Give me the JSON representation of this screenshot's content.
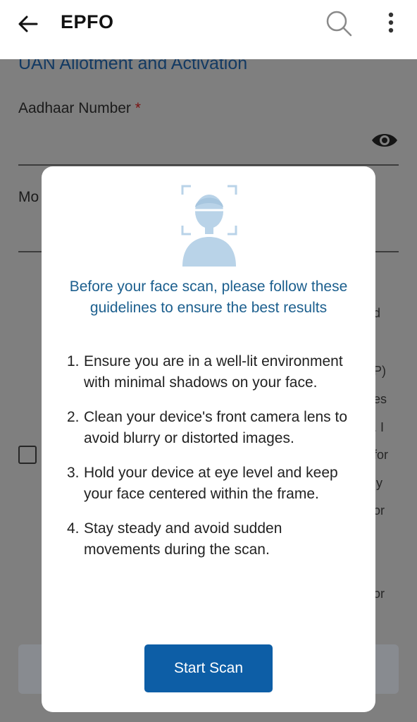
{
  "app_bar": {
    "title": "EPFO",
    "back_icon": "arrow-left-icon",
    "search_icon": "search-icon",
    "more_icon": "more-vert-icon"
  },
  "form": {
    "section_title": "UAN Allotment and Activation",
    "aadhaar_label": "Aadhaar Number",
    "required_mark": "*",
    "mobile_label_partial": "Mo",
    "visibility_icon": "eye-icon",
    "right_fragments": [
      "d",
      "P)",
      "es",
      ". I",
      "for",
      "ly",
      "or",
      "or"
    ]
  },
  "dialog": {
    "illustration_icon": "face-scan-icon",
    "heading": "Before your face scan, please follow these guidelines to ensure the best results",
    "guidelines": [
      {
        "num": "1.",
        "text": "Ensure you are in a well-lit environment with minimal shadows on your face."
      },
      {
        "num": "2.",
        "text": "Clean your device's front camera lens to avoid blurry or distorted images."
      },
      {
        "num": "3.",
        "text": "Hold your device at eye level and keep your face centered within the frame."
      },
      {
        "num": "4.",
        "text": "Stay steady and avoid sudden movements during the scan."
      }
    ],
    "start_button": "Start Scan"
  },
  "colors": {
    "primary_button": "#0d5ea6",
    "heading": "#1c5f8e",
    "overlay": "#7f7f7f"
  }
}
